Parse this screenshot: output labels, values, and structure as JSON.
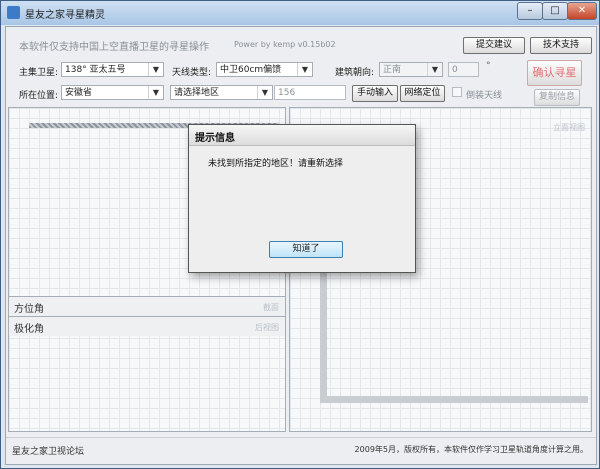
{
  "window": {
    "title": "星友之家寻星精灵"
  },
  "header": {
    "description": "本软件仅支持中国上空直播卫星的寻星操作",
    "version": "Power by kemp  v0.15b02",
    "feedback_button": "提交建议",
    "support_button": "技术支持",
    "confirm_button": "确认寻星",
    "copy_info_button": "复制信息"
  },
  "form": {
    "satellite_label": "主集卫星:",
    "satellite_value": "138°   亚太五号",
    "antenna_label": "天线类型:",
    "antenna_value": "中卫60cm偏馈",
    "orientation_label": "建筑朝向:",
    "orientation_value": "正南",
    "angle_value": "0",
    "degree_symbol": "°",
    "location_label": "所在位置:",
    "province_value": "安徽省",
    "region_placeholder": "请选择地区",
    "longitude_value": "156",
    "manual_input_button": "手动输入",
    "network_locate_button": "网络定位",
    "flip_antenna_label": "倒装天线"
  },
  "panels": {
    "azimuth_label": "方位角",
    "azimuth_ghost": "截面",
    "elevation_label": "极化角",
    "elevation_ghost": "后视图",
    "elevation_view_ghost": "立面视图"
  },
  "statusbar": {
    "forum": "星友之家卫视论坛",
    "copyright": "2009年5月，版权所有，本软件仅作学习卫星轨道角度计算之用。"
  },
  "dialog": {
    "title": "提示信息",
    "message": "未找到所指定的地区！请重新选择",
    "ok_button": "知道了"
  }
}
